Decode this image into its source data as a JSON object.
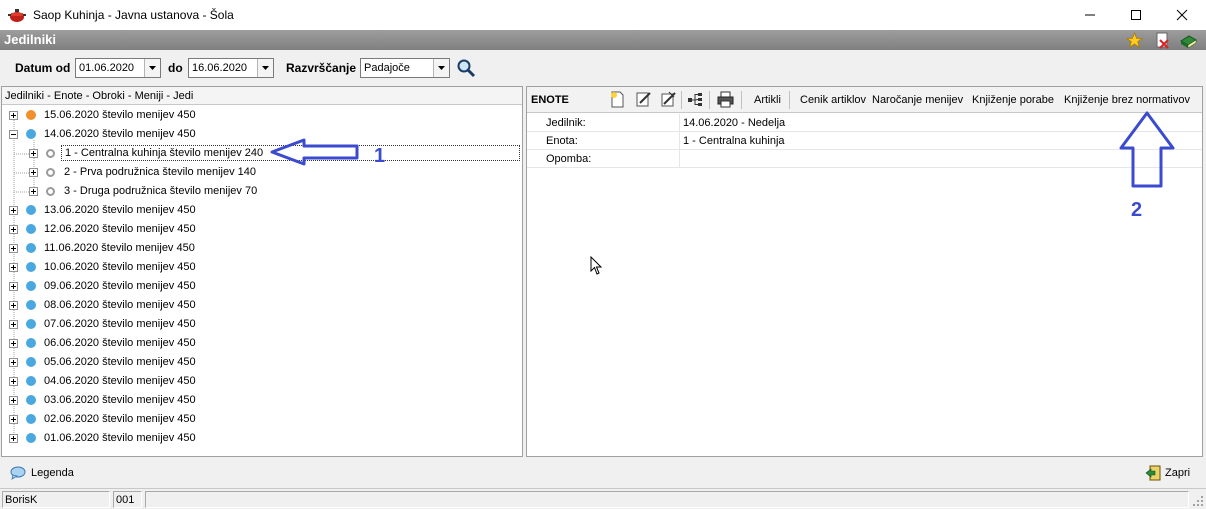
{
  "window": {
    "title": "Saop Kuhinja  - Javna ustanova - Šola"
  },
  "module": {
    "title": "Jedilniki"
  },
  "filter": {
    "date_from_label": "Datum od",
    "date_from": "01.06.2020",
    "date_to_label": "do",
    "date_to": "16.06.2020",
    "sort_label": "Razvrščanje",
    "sort_value": "Padajoče"
  },
  "tree": {
    "header": "Jedilniki - Enote - Obroki - Meniji - Jedi",
    "rows": [
      {
        "text": "15.06.2020   število menijev 450",
        "dot": "orange",
        "expanded": false,
        "level": 0
      },
      {
        "text": "14.06.2020   število menijev 450",
        "dot": "blue",
        "expanded": true,
        "level": 0
      },
      {
        "text": "1 - Centralna kuhinja   število menijev 240",
        "dot": "ring",
        "expanded": false,
        "level": 1,
        "selected": true
      },
      {
        "text": "2 - Prva podružnica   število menijev 140",
        "dot": "ring",
        "expanded": false,
        "level": 1
      },
      {
        "text": "3 - Druga podružnica   število menijev 70",
        "dot": "ring",
        "expanded": false,
        "level": 1
      },
      {
        "text": "13.06.2020   število menijev 450",
        "dot": "blue",
        "expanded": false,
        "level": 0
      },
      {
        "text": "12.06.2020   število menijev 450",
        "dot": "blue",
        "expanded": false,
        "level": 0
      },
      {
        "text": "11.06.2020   število menijev 450",
        "dot": "blue",
        "expanded": false,
        "level": 0
      },
      {
        "text": "10.06.2020   število menijev 450",
        "dot": "blue",
        "expanded": false,
        "level": 0
      },
      {
        "text": "09.06.2020   število menijev 450",
        "dot": "blue",
        "expanded": false,
        "level": 0
      },
      {
        "text": "08.06.2020   število menijev 450",
        "dot": "blue",
        "expanded": false,
        "level": 0
      },
      {
        "text": "07.06.2020   število menijev 450",
        "dot": "blue",
        "expanded": false,
        "level": 0
      },
      {
        "text": "06.06.2020   število menijev 450",
        "dot": "blue",
        "expanded": false,
        "level": 0
      },
      {
        "text": "05.06.2020   število menijev 450",
        "dot": "blue",
        "expanded": false,
        "level": 0
      },
      {
        "text": "04.06.2020   število menijev 450",
        "dot": "blue",
        "expanded": false,
        "level": 0
      },
      {
        "text": "03.06.2020   število menijev 450",
        "dot": "blue",
        "expanded": false,
        "level": 0
      },
      {
        "text": "02.06.2020   število menijev 450",
        "dot": "blue",
        "expanded": false,
        "level": 0
      },
      {
        "text": "01.06.2020   število menijev 450",
        "dot": "blue",
        "expanded": false,
        "level": 0
      }
    ]
  },
  "right": {
    "title": "ENOTE",
    "links": {
      "artikli": "Artikli",
      "cenik": "Cenik artiklov",
      "narocanje": "Naročanje menijev",
      "porabe": "Knjiženje porabe",
      "brez": "Knjiženje brez normativov"
    },
    "props": [
      {
        "label": "Jedilnik:",
        "value": "14.06.2020 - Nedelja"
      },
      {
        "label": "Enota:",
        "value": "1 - Centralna kuhinja"
      },
      {
        "label": "Opomba:",
        "value": ""
      }
    ]
  },
  "bottom": {
    "legend": "Legenda",
    "close": "Zapri"
  },
  "status": {
    "user": "BorisK",
    "code": "001"
  },
  "annotations": {
    "one": "1",
    "two": "2"
  },
  "colors": {
    "annotation": "#3b4bd0",
    "dot_blue": "#4aa8e0",
    "dot_orange": "#f0902a",
    "header_gray": "#8a8a8a"
  }
}
